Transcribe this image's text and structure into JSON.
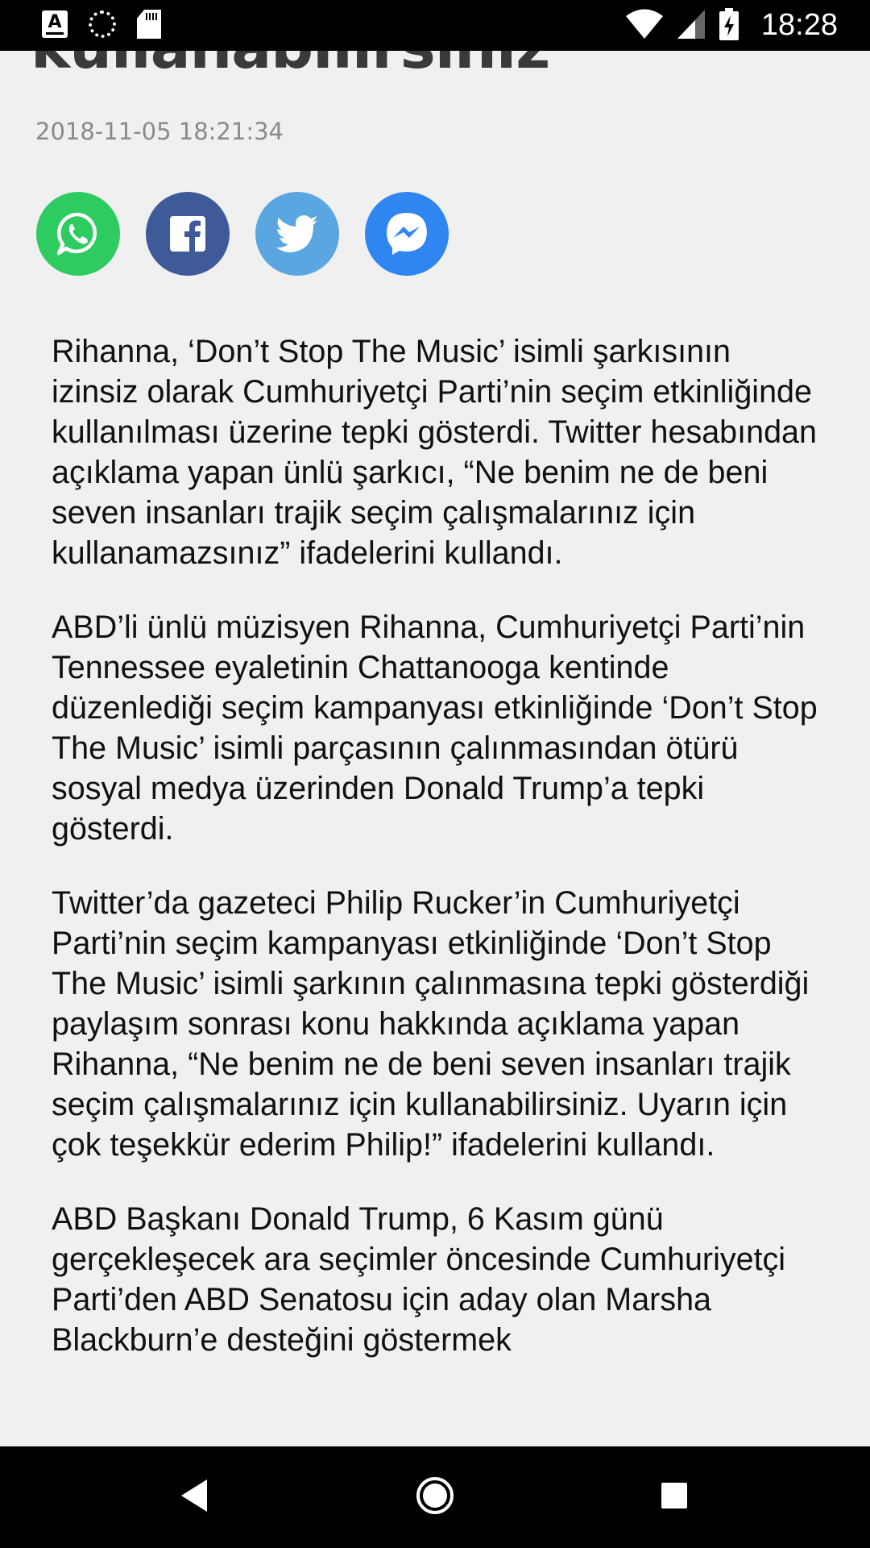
{
  "status_bar": {
    "time": "18:28",
    "icons_left": [
      "font-a-icon",
      "loading-spinner-icon",
      "sd-card-icon"
    ],
    "icons_right": [
      "wifi-icon",
      "cell-signal-icon",
      "battery-charging-icon"
    ]
  },
  "article": {
    "headline_visible_fragment": "kullanabilirsiniz",
    "timestamp": "2018-11-05 18:21:34",
    "share_buttons": [
      {
        "name": "whatsapp",
        "icon": "whatsapp-icon",
        "color": "#2ecb61"
      },
      {
        "name": "facebook",
        "icon": "facebook-icon",
        "color": "#3e5a99"
      },
      {
        "name": "twitter",
        "icon": "twitter-icon",
        "color": "#5aa6e0"
      },
      {
        "name": "messenger",
        "icon": "messenger-icon",
        "color": "#2f86f0"
      }
    ],
    "paragraphs": [
      "Rihanna, ‘Don’t Stop The Music’ isimli şarkısının izinsiz olarak Cumhuriyetçi Parti’nin seçim etkinliğinde kullanılması üzerine tepki gösterdi. Twitter hesabından açıklama yapan ünlü şarkıcı, “Ne benim ne de beni seven insanları trajik seçim çalışmalarınız için kullanamazsınız” ifadelerini kullandı.",
      "ABD’li ünlü müzisyen Rihanna, Cumhuriyetçi Parti’nin Tennessee eyaletinin Chattanooga kentinde düzenlediği seçim kampanyası etkinliğinde ‘Don’t Stop The Music’ isimli parçasının çalınmasından ötürü sosyal medya üzerinden Donald Trump’a tepki gösterdi.",
      "Twitter’da gazeteci Philip Rucker’in Cumhuriyetçi Parti’nin seçim kampanyası etkinliğinde ‘Don’t Stop The Music’ isimli şarkının çalınmasına tepki gösterdiği paylaşım sonrası konu hakkında açıklama yapan Rihanna, “Ne benim ne de beni seven insanları trajik seçim çalışmalarınız için kullanabilirsiniz. Uyarın için çok teşekkür ederim Philip!” ifadelerini kullandı.",
      "ABD Başkanı Donald Trump, 6 Kasım günü gerçekleşecek ara seçimler öncesinde Cumhuriyetçi Parti’den ABD Senatosu için aday olan Marsha Blackburn’e desteğini göstermek"
    ]
  },
  "nav_bar": {
    "buttons": [
      "back-icon",
      "home-icon",
      "recent-apps-icon"
    ]
  }
}
